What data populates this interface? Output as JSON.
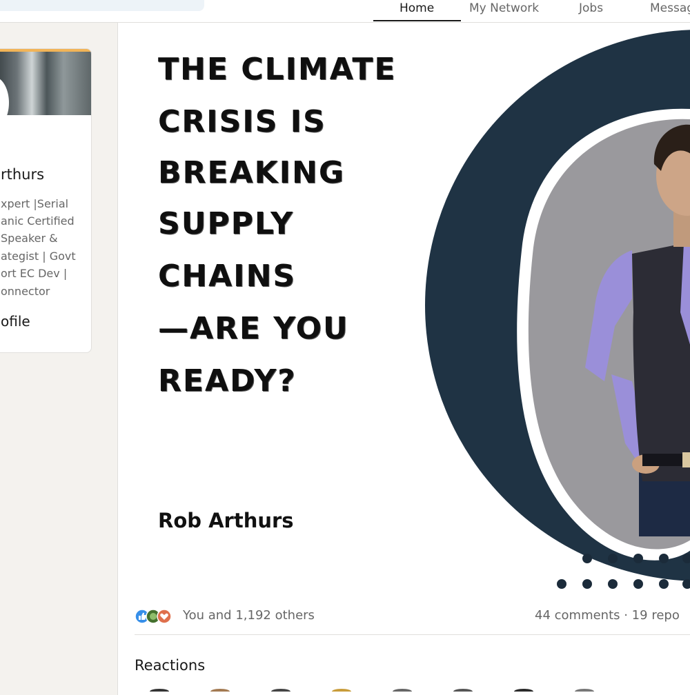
{
  "nav": {
    "items": [
      {
        "label": "Home",
        "active": true
      },
      {
        "label": "My Network"
      },
      {
        "label": "Jobs"
      },
      {
        "label": "Messag"
      }
    ]
  },
  "profile": {
    "name": "rthurs",
    "headline_lines": [
      "xpert |Serial",
      "anic Certified",
      "Speaker &",
      "ategist | Govt",
      "ort EC Dev |",
      "onnector"
    ],
    "view_profile_label": "ofile"
  },
  "post": {
    "image": {
      "quote_lines": [
        "THE CLIMATE",
        "CRISIS IS",
        "BREAKING",
        "SUPPLY",
        "CHAINS",
        "—ARE YOU",
        "READY?"
      ],
      "author_credit": "Rob Arthurs",
      "palette": {
        "dark_shape": "#1f3344",
        "photo_bg": "#9a999d",
        "shirt": "#9a8fd9",
        "vest": "#2c2c35"
      }
    },
    "social": {
      "reaction_icons": [
        "like-icon",
        "support-icon",
        "love-icon"
      ],
      "reactions_summary": "You and 1,192 others",
      "comments_reposts": "44 comments · 19 repo"
    },
    "reactions_section": {
      "heading": "Reactions"
    }
  }
}
